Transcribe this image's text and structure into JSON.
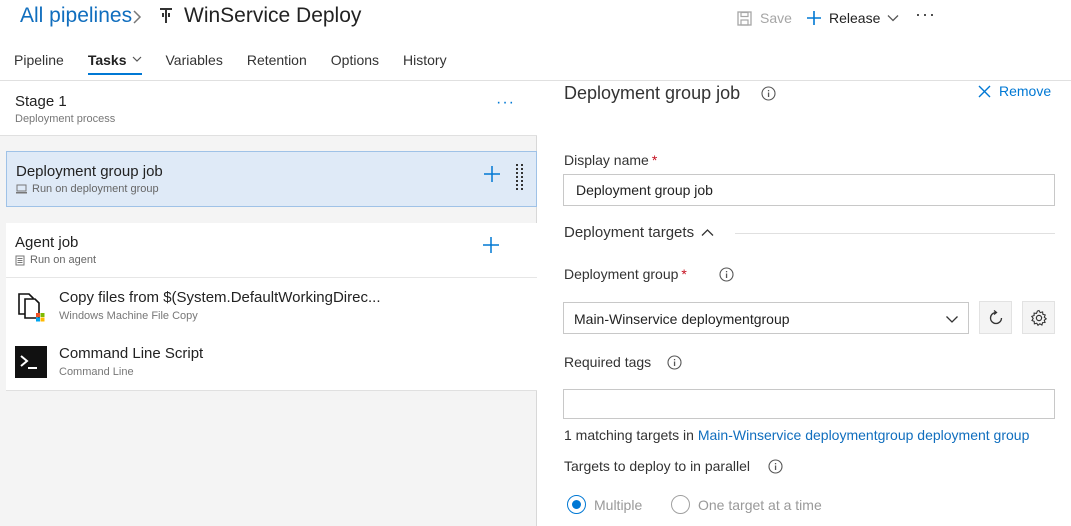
{
  "colors": {
    "accent": "#0078d4",
    "link": "#106ebe",
    "selected_bg": "#dfeaf7",
    "required": "#c50f1f"
  },
  "header": {
    "breadcrumb_root": "All pipelines",
    "title": "WinService Deploy",
    "save_label": "Save",
    "release_label": "Release",
    "more_label": "···"
  },
  "tabs": [
    {
      "label": "Pipeline"
    },
    {
      "label": "Tasks"
    },
    {
      "label": "Variables"
    },
    {
      "label": "Retention"
    },
    {
      "label": "Options"
    },
    {
      "label": "History"
    }
  ],
  "stage": {
    "title": "Stage 1",
    "subtitle": "Deployment process",
    "more_label": "···"
  },
  "jobs": {
    "deployment_group_job": {
      "title": "Deployment group job",
      "subtitle": "Run on deployment group"
    },
    "agent_job": {
      "title": "Agent job",
      "subtitle": "Run on agent"
    }
  },
  "tasks": [
    {
      "title": "Copy files from $(System.DefaultWorkingDirec...",
      "subtitle": "Windows Machine File Copy",
      "icon": "file-copy-icon"
    },
    {
      "title": "Command Line Script",
      "subtitle": "Command Line",
      "icon": "command-line-icon"
    }
  ],
  "details": {
    "title": "Deployment group job",
    "remove_label": "Remove",
    "display_name_label": "Display name",
    "display_name_value": "Deployment group job",
    "required_mark": "*",
    "section_title": "Deployment targets",
    "deployment_group_label": "Deployment group",
    "deployment_group_value": "Main-Winservice deploymentgroup",
    "required_tags_label": "Required tags",
    "required_tags_value": "",
    "matching_prefix": "1 matching targets in",
    "matching_link": "Main-Winservice deploymentgroup deployment group",
    "parallel_label": "Targets to deploy to in parallel",
    "parallel_options": [
      {
        "label": "Multiple",
        "selected": true
      },
      {
        "label": "One target at a time",
        "selected": false
      }
    ]
  }
}
